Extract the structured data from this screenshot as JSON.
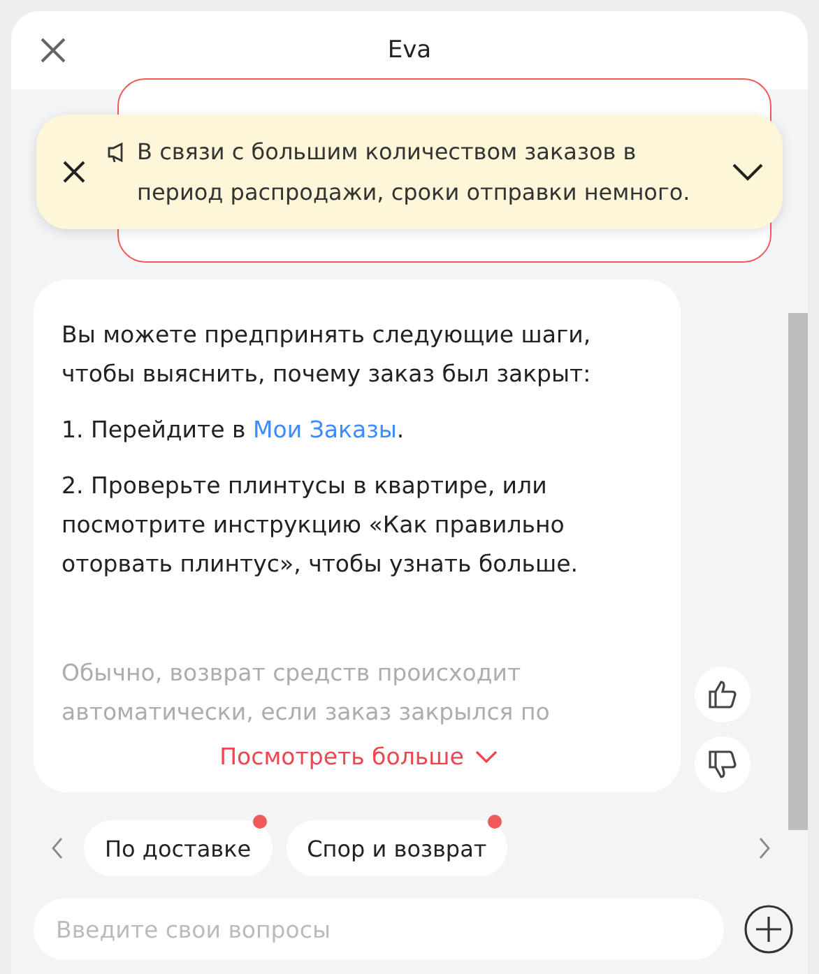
{
  "header": {
    "title": "Eva"
  },
  "notice": {
    "text": "В связи с большим количеством заказов в период распродажи, сроки отправки немного."
  },
  "message": {
    "paragraphs": [
      {
        "kind": "text",
        "text": "Вы можете предпринять следующие шаги, чтобы выяснить, почему заказ был закрыт:"
      },
      {
        "kind": "link",
        "before": "1. Перейдите в ",
        "link": "Мои Заказы",
        "after": "."
      },
      {
        "kind": "text",
        "text": "2. Проверьте плинтусы в квартире, или посмотрите инструкцию «Как правильно оторвать плинтус», чтобы узнать больше."
      },
      {
        "kind": "faded",
        "text": "Обычно, возврат средств происходит автоматически, если заказ закрылся по"
      }
    ],
    "see_more": "Посмотреть больше"
  },
  "chips": [
    {
      "label": "По доставке",
      "dot": true
    },
    {
      "label": "Спор и возврат",
      "dot": true
    }
  ],
  "input": {
    "placeholder": "Введите свои вопросы"
  }
}
